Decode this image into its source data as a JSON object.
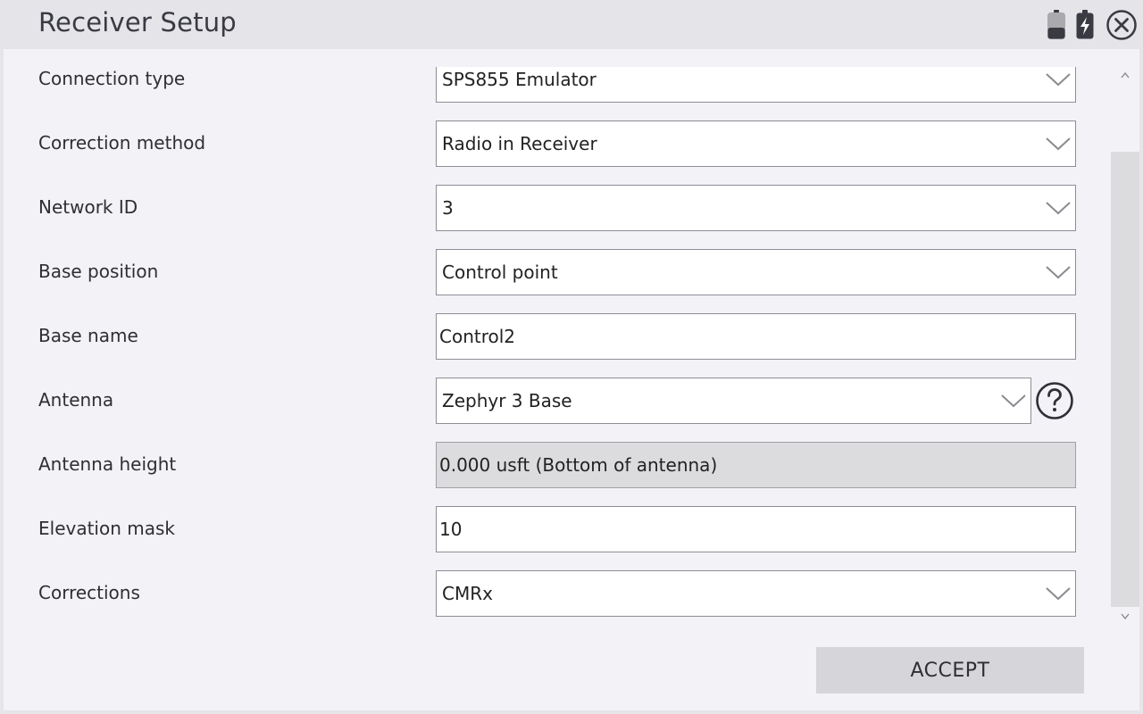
{
  "window": {
    "title": "Receiver Setup",
    "icons": [
      "battery-icon",
      "battery-charging-icon",
      "close-icon"
    ]
  },
  "form": {
    "fields": [
      {
        "label": "Connection type",
        "value": "SPS855 Emulator",
        "kind": "select"
      },
      {
        "label": "Correction method",
        "value": "Radio in Receiver",
        "kind": "select"
      },
      {
        "label": "Network ID",
        "value": "3",
        "kind": "select"
      },
      {
        "label": "Base position",
        "value": "Control point",
        "kind": "select"
      },
      {
        "label": "Base name",
        "value": "Control2",
        "kind": "text"
      },
      {
        "label": "Antenna",
        "value": "Zephyr 3 Base",
        "kind": "select-with-help"
      },
      {
        "label": "Antenna height",
        "value": "0.000 usft (Bottom of antenna)",
        "kind": "disabled"
      },
      {
        "label": "Elevation mask",
        "value": "10",
        "kind": "text"
      },
      {
        "label": "Corrections",
        "value": "CMRx",
        "kind": "select"
      }
    ]
  },
  "actions": {
    "accept_label": "ACCEPT"
  }
}
